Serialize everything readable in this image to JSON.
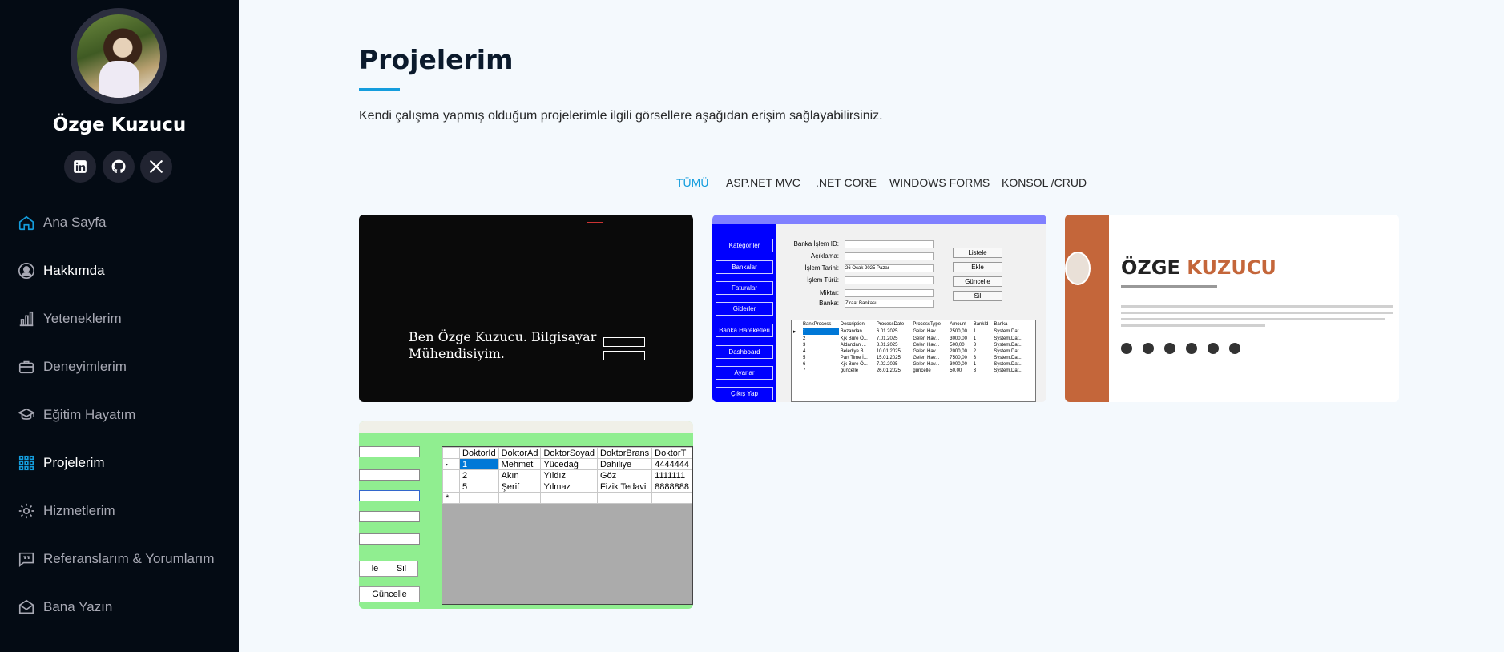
{
  "profile": {
    "name": "Özge Kuzucu"
  },
  "social": [
    {
      "name": "linkedin-icon"
    },
    {
      "name": "github-icon"
    },
    {
      "name": "x-icon"
    }
  ],
  "nav": [
    {
      "label": "Ana Sayfa",
      "icon": "home-icon",
      "active": false
    },
    {
      "label": "Hakkımda",
      "icon": "person-icon",
      "active": false
    },
    {
      "label": "Yeteneklerim",
      "icon": "bar-chart-icon",
      "active": false
    },
    {
      "label": "Deneyimlerim",
      "icon": "briefcase-icon",
      "active": false
    },
    {
      "label": "Eğitim Hayatım",
      "icon": "graduation-cap-icon",
      "active": false
    },
    {
      "label": "Projelerim",
      "icon": "grid-icon",
      "active": true
    },
    {
      "label": "Hizmetlerim",
      "icon": "gear-icon",
      "active": false
    },
    {
      "label": "Referanslarım & Yorumlarım",
      "icon": "quote-icon",
      "active": false
    },
    {
      "label": "Bana Yazın",
      "icon": "envelope-icon",
      "active": false
    }
  ],
  "main": {
    "title": "Projelerim",
    "intro": "Kendi çalışma yapmış olduğum projelerimle ilgili görsellere aşağıdan erişim sağlayabilirsiniz.",
    "filters": [
      "TÜMÜ",
      "ASP.NET MVC",
      ".NET CORE",
      "WINDOWS FORMS",
      "KONSOL /CRUD"
    ],
    "active_filter": "TÜMÜ"
  },
  "projects": {
    "p1": {
      "headline": "Ben Özge Kuzucu. Bilgisayar Mühendisiyim."
    },
    "p2": {
      "window_title": "Banka Hareketleri",
      "side_buttons": [
        "Kategoriler",
        "Bankalar",
        "Faturalar",
        "Giderler",
        "Banka Hareketleri",
        "Dashboard",
        "Ayarlar",
        "Çıkış Yap"
      ],
      "labels": [
        "Banka İşlem ID:",
        "Açıklama:",
        "İşlem Tarihi:",
        "İşlem Türü:",
        "Miktar:",
        "Banka:"
      ],
      "date_value": "26 Ocak 2025 Pazar",
      "bank_value": "Ziraat Bankası",
      "action_buttons": [
        "Listele",
        "Ekle",
        "Güncelle",
        "Sil"
      ],
      "grid_headers": [
        "BankProcess",
        "Description",
        "ProcessDate",
        "ProcessType",
        "Amount",
        "BankId",
        "Banka"
      ],
      "grid_rows": [
        [
          "1",
          "Bozandan ...",
          "6.01.2025",
          "Gelen Hav...",
          "2500,00",
          "1",
          "System.Dat..."
        ],
        [
          "2",
          "Kjk Bure Ö...",
          "7.01.2025",
          "Gelen Hav...",
          "3000,00",
          "1",
          "System.Dat..."
        ],
        [
          "3",
          "Aldandan ...",
          "8.01.2025",
          "Gelen Hav...",
          "500,00",
          "3",
          "System.Dat..."
        ],
        [
          "4",
          "Belediye B...",
          "10.01.2025",
          "Gelen Hav...",
          "2000,00",
          "2",
          "System.Dat..."
        ],
        [
          "5",
          "Part Time İ...",
          "15.01.2025",
          "Gelen Hav...",
          "7500,00",
          "3",
          "System.Dat..."
        ],
        [
          "6",
          "Kjk Bure Ö...",
          "7.02.2025",
          "Gelen Hav...",
          "3000,00",
          "1",
          "System.Dat..."
        ],
        [
          "7",
          "güncelle",
          "26.01.2025",
          "güncelle",
          "50,00",
          "3",
          "System.Dat..."
        ]
      ]
    },
    "p3": {
      "name_first": "ÖZGE",
      "name_last": "KUZUCU"
    },
    "p4": {
      "buttons": [
        "le",
        "Sil",
        "Güncelle"
      ],
      "grid_headers": [
        "DoktorId",
        "DoktorAd",
        "DoktorSoyad",
        "DoktorBrans",
        "DoktorT"
      ],
      "grid_rows": [
        [
          "1",
          "Mehmet",
          "Yücedağ",
          "Dahiliye",
          "4444444"
        ],
        [
          "2",
          "Akın",
          "Yıldız",
          "Göz",
          "1111111"
        ],
        [
          "5",
          "Şerif",
          "Yılmaz",
          "Fizik Tedavi",
          "8888888"
        ]
      ]
    }
  },
  "colors": {
    "accent": "#149ddd",
    "sidebar": "#040b14",
    "background": "#f4f9fd"
  }
}
